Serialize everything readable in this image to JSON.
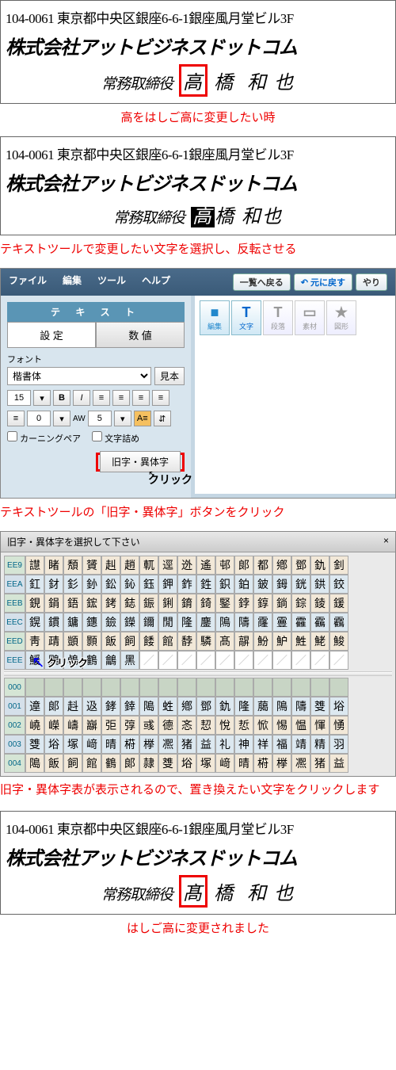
{
  "card1": {
    "addr": "104-0061 東京都中央区銀座6-6-1銀座風月堂ビル3F",
    "co": "株式会社アットビジネスドットコム",
    "title": "常務取締役",
    "n1": "高",
    "n2": "橋",
    "n3": "和",
    "n4": "也",
    "cap": "高をはしご高に変更したい時"
  },
  "card2": {
    "addr": "104-0061 東京都中央区銀座6-6-1銀座風月堂ビル3F",
    "co": "株式会社アットビジネスドットコム",
    "title": "常務取締役",
    "n1": "高",
    "n2": "橋 和也",
    "cap": "テキストツールで変更したい文字を選択し、反転させる"
  },
  "app": {
    "menu": {
      "file": "ファイル",
      "edit": "編集",
      "tool": "ツール",
      "help": "ヘルプ",
      "back": "一覧へ戻る",
      "undo": "元に戻す",
      "redo": "やり"
    },
    "panel": {
      "title": "テ キ ス ト",
      "tab1": "設 定",
      "tab2": "数 値",
      "fontlbl": "フォント",
      "font": "楷書体",
      "sample": "見本",
      "size": "15",
      "line": "0",
      "aw": "AW",
      "awv": "5",
      "kerning": "カーニングペア",
      "pack": "文字詰め",
      "old": "旧字・異体字",
      "click": "クリック"
    },
    "rtool": {
      "edit": "編集",
      "editic": "■",
      "text": "文字",
      "textic": "T",
      "t3": "段落",
      "t4": "素材",
      "t5": "図形"
    }
  },
  "cap3": "テキストツールの「旧字・異体字」ボタンをクリック",
  "grid": {
    "title": "旧字・異体字を選択して下さい",
    "close": "×",
    "click": "クリック",
    "heads": [
      "EE9",
      "EEA",
      "EEB",
      "EEC",
      "EED",
      "EEE",
      "000",
      "001",
      "002",
      "003",
      "004"
    ],
    "rows": [
      [
        "譿",
        "睹",
        "頽",
        "贇",
        "赳",
        "趙",
        "軏",
        "逕",
        "迯",
        "遙",
        "邨",
        "郞",
        "都",
        "鄕",
        "鄧",
        "釚",
        "釗"
      ],
      [
        "釭",
        "釮",
        "釤",
        "釥",
        "鈆",
        "鈊",
        "鈺",
        "鉀",
        "鈼",
        "鉎",
        "鉙",
        "鉑",
        "鈹",
        "鉧",
        "銧",
        "鉷",
        "鉸"
      ],
      [
        "鋧",
        "鋗",
        "鋙",
        "鋐",
        "銬",
        "鋕",
        "鋠",
        "鋓",
        "錥",
        "錡",
        "鋻",
        "鋍",
        "錞",
        "鋿",
        "錝",
        "錂",
        "鍰"
      ],
      [
        "鎤",
        "鏆",
        "鏞",
        "鏸",
        "鐱",
        "鑅",
        "鑈",
        "閒",
        "隆",
        "鏖",
        "隝",
        "隯",
        "霳",
        "霻",
        "靃",
        "靍",
        "靏"
      ],
      [
        "靑",
        "靕",
        "顗",
        "顥",
        "飯",
        "飼",
        "餧",
        "館",
        "馞",
        "驎",
        "髙",
        "髜",
        "魵",
        "魲",
        "鮏",
        "鮱",
        "鮻"
      ],
      [
        "鰀",
        "鵰",
        "鵫",
        "鶴",
        "鸙",
        "黑",
        "",
        "",
        "",
        "",
        "",
        "",
        "",
        "",
        "",
        "",
        ""
      ],
      [
        "",
        "",
        "",
        "",
        "",
        "",
        "",
        "",
        "",
        "",
        "",
        "",
        "",
        "",
        "",
        "",
        ""
      ],
      [
        "遧",
        "郞",
        "﨣",
        "﨤",
        "﨧",
        "﨨",
        "﨩",
        "﨡",
        "鄕",
        "鄧",
        "釚",
        "隆",
        "﨟",
        "隝",
        "隯",
        "﨎",
        "﨏"
      ],
      [
        "嶢",
        "嶸",
        "嶹",
        "巐",
        "弡",
        "弴",
        "彧",
        "德",
        "忞",
        "恝",
        "悅",
        "悊",
        "惞",
        "惕",
        "愠",
        "惲",
        "愑"
      ],
      [
        "﨎",
        "﨏",
        "塚",
        "﨑",
        "晴",
        "﨓",
        "﨔",
        "凞",
        "猪",
        "益",
        "礼",
        "神",
        "祥",
        "福",
        "靖",
        "精",
        "羽"
      ],
      [
        "﨩",
        "飯",
        "飼",
        "館",
        "鶴",
        "郞",
        "隷",
        "﨎",
        "﨏",
        "塚",
        "﨑",
        "晴",
        "﨓",
        "﨔",
        "凞",
        "猪",
        "益"
      ]
    ]
  },
  "cap4": "旧字・異体字表が表示されるので、置き換えたい文字をクリックします",
  "card3": {
    "addr": "104-0061 東京都中央区銀座6-6-1銀座風月堂ビル3F",
    "co": "株式会社アットビジネスドットコム",
    "title": "常務取締役",
    "n1": "髙",
    "n2": "橋",
    "n3": "和",
    "n4": "也",
    "cap": "はしご高に変更されました"
  }
}
